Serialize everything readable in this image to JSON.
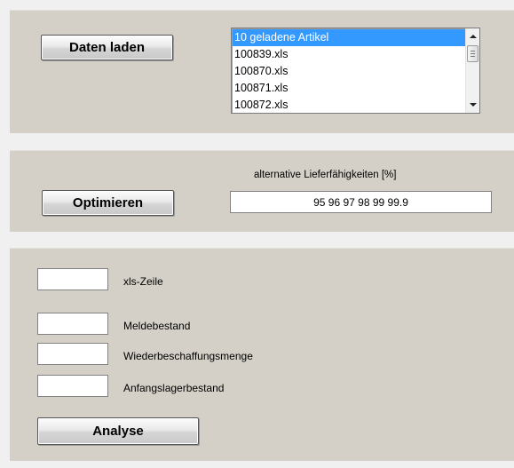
{
  "load_panel": {
    "button_label": "Daten laden",
    "list": {
      "items": [
        "10 geladene Artikel",
        "100839.xls",
        "100870.xls",
        "100871.xls",
        "100872.xls"
      ],
      "selected_index": 0
    }
  },
  "optimize_panel": {
    "button_label": "Optimieren",
    "alternatives_label": "alternative Lieferfähigkeiten [%]",
    "alternatives_value": "95 96 97 98 99 99.9"
  },
  "analysis_panel": {
    "fields": [
      {
        "label": "xls-Zeile",
        "value": ""
      },
      {
        "label": "Meldebestand",
        "value": ""
      },
      {
        "label": "Wiederbeschaffungsmenge",
        "value": ""
      },
      {
        "label": "Anfangslagerbestand",
        "value": ""
      }
    ],
    "button_label": "Analyse"
  },
  "colors": {
    "panel_background": "#d4d0c8",
    "page_background": "#f0f0f0",
    "selection": "#3399ff"
  },
  "icons": [
    "scroll-up-arrow-icon",
    "scroll-down-arrow-icon",
    "scroll-thumb-grip-icon"
  ]
}
